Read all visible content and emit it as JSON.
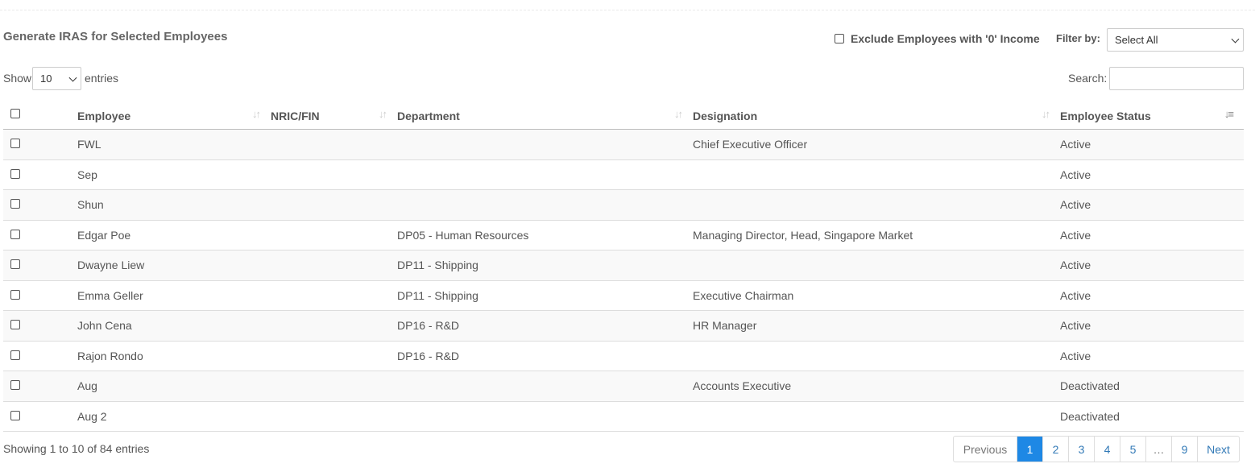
{
  "title": "Generate IRAS for Selected Employees",
  "exclude_label": "Exclude Employees with '0' Income",
  "filter": {
    "label": "Filter by:",
    "selected": "Select All"
  },
  "length": {
    "show": "Show",
    "selected": "10",
    "entries": "entries"
  },
  "search": {
    "label": "Search:",
    "value": ""
  },
  "columns": [
    "Employee",
    "NRIC/FIN",
    "Department",
    "Designation",
    "Employee Status"
  ],
  "rows": [
    {
      "employee": "FWL",
      "nric": "",
      "department": "",
      "designation": "Chief Executive Officer",
      "status": "Active"
    },
    {
      "employee": "Sep",
      "nric": "",
      "department": "",
      "designation": "",
      "status": "Active"
    },
    {
      "employee": "Shun",
      "nric": "",
      "department": "",
      "designation": "",
      "status": "Active"
    },
    {
      "employee": "Edgar Poe",
      "nric": "",
      "department": "DP05 - Human Resources",
      "designation": "Managing Director, Head, Singapore Market",
      "status": "Active"
    },
    {
      "employee": "Dwayne Liew",
      "nric": "",
      "department": "DP11 - Shipping",
      "designation": "",
      "status": "Active"
    },
    {
      "employee": "Emma Geller",
      "nric": "",
      "department": "DP11 - Shipping",
      "designation": "Executive Chairman",
      "status": "Active"
    },
    {
      "employee": "John Cena",
      "nric": "",
      "department": "DP16 - R&D",
      "designation": "HR Manager",
      "status": "Active"
    },
    {
      "employee": "Rajon Rondo",
      "nric": "",
      "department": "DP16 - R&D",
      "designation": "",
      "status": "Active"
    },
    {
      "employee": "Aug",
      "nric": "",
      "department": "",
      "designation": "Accounts Executive",
      "status": "Deactivated"
    },
    {
      "employee": "Aug 2",
      "nric": "",
      "department": "",
      "designation": "",
      "status": "Deactivated"
    }
  ],
  "info": "Showing 1 to 10 of 84 entries",
  "pagination": {
    "previous": "Previous",
    "pages": [
      "1",
      "2",
      "3",
      "4",
      "5",
      "…",
      "9"
    ],
    "current": "1",
    "next": "Next"
  },
  "colors": {
    "accent": "#1e88e5",
    "link": "#337ab7",
    "stripe": "#f9f9f9"
  }
}
